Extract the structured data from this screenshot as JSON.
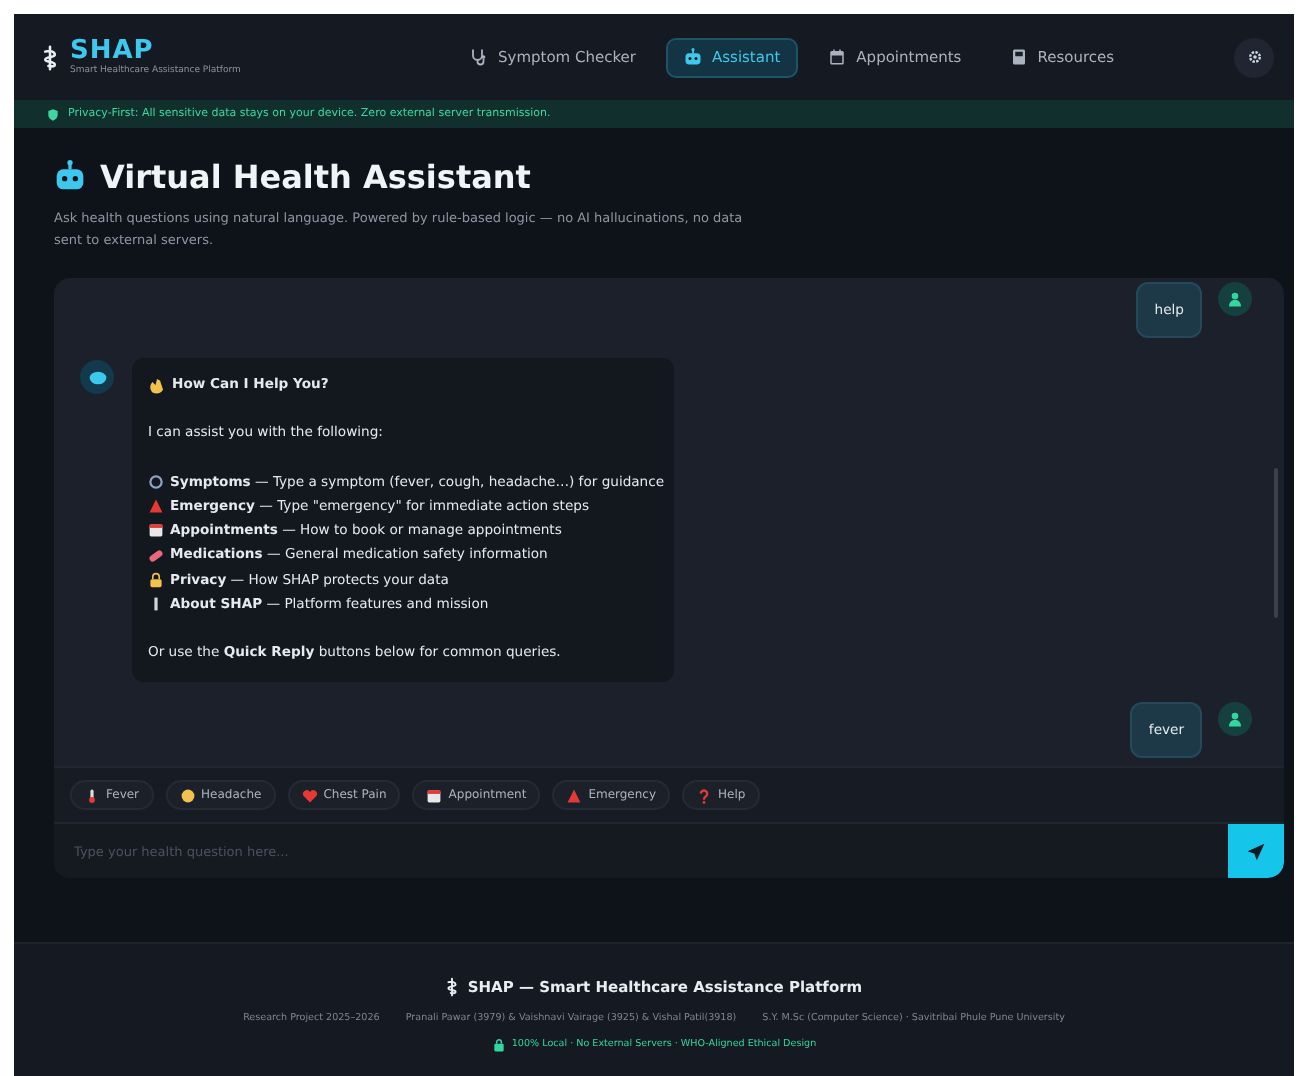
{
  "header": {
    "logo": "SHAP",
    "tagline": "Smart Healthcare Assistance Platform",
    "nav": [
      {
        "label": "Symptom Checker",
        "selected": false
      },
      {
        "label": "Assistant",
        "selected": true
      },
      {
        "label": "Appointments",
        "selected": false
      },
      {
        "label": "Resources",
        "selected": false
      }
    ]
  },
  "privacy_banner": "Privacy-First: All sensitive data stays on your device. Zero external server transmission.",
  "page": {
    "title": "Virtual Health Assistant",
    "description": "Ask health questions using natural language. Powered by rule-based logic — no AI hallucinations, no data sent to external servers."
  },
  "chat": {
    "messages": [
      {
        "kind": "user",
        "text": "help"
      },
      {
        "kind": "bot",
        "heading": "How Can I Help You?",
        "intro": "I can assist you with the following:",
        "items": [
          "**Symptoms** — Type a symptom (fever, cough, headache…) for guidance",
          "**Emergency** — Type \"emergency\" for immediate action steps",
          "**Appointments** — How to book or manage appointments",
          "**Medications** — General medication safety information",
          "**Privacy** — How SHAP protects your data",
          "**About SHAP** — Platform features and mission"
        ],
        "outro": "Or use the **Quick Reply** buttons below for common queries."
      },
      {
        "kind": "user",
        "text": "fever"
      }
    ],
    "quick_replies": [
      "Fever",
      "Headache",
      "Chest Pain",
      "Appointment",
      "Emergency",
      "Help"
    ],
    "input": {
      "placeholder": "Type your health question here..."
    }
  },
  "footer": {
    "title": "SHAP — Smart Healthcare Assistance Platform",
    "credits": [
      "Research Project 2025–2026",
      "Pranali Pawar (3979) & Vaishnavi Vairage (3925) & Vishal Patil(3918)",
      "S.Y. M.Sc (Computer Science) · Savitribai Phule Pune University"
    ],
    "badge": "100% Local · No External Servers · WHO-Aligned Ethical Design"
  }
}
